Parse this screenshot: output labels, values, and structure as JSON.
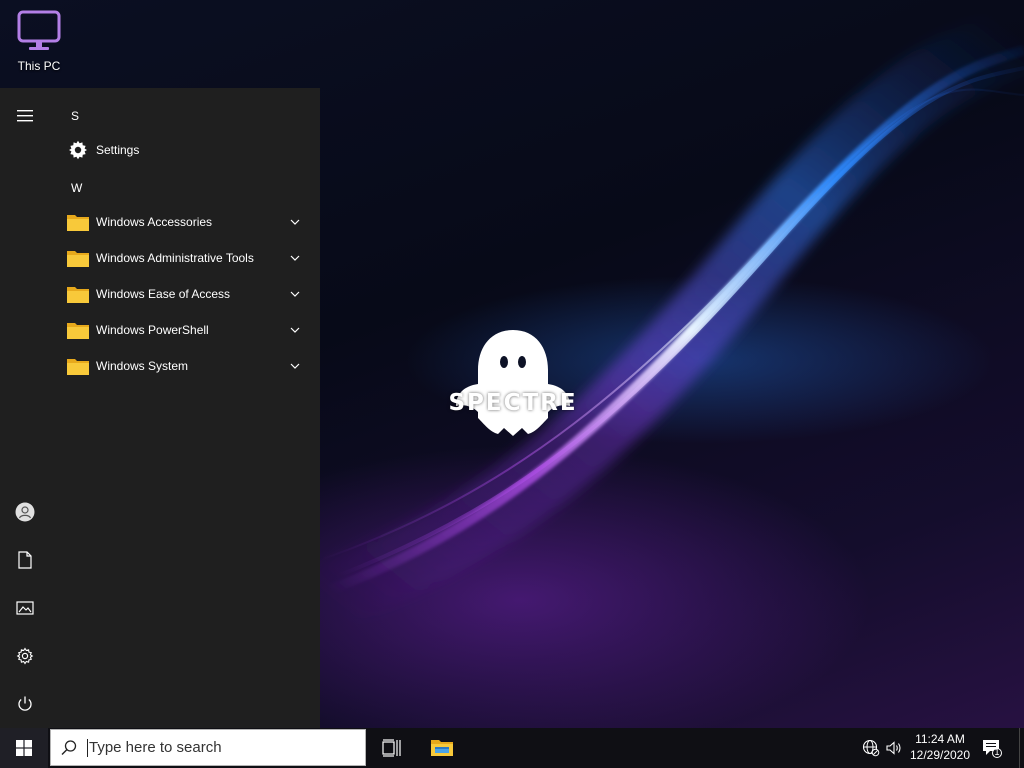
{
  "desktop": {
    "icons": [
      {
        "label": "This PC"
      }
    ],
    "wallpaper_logo_text": "SPECTRE"
  },
  "start_menu": {
    "groups": [
      {
        "letter": "S",
        "items": [
          {
            "label": "Settings",
            "icon": "gear-icon",
            "expandable": false
          }
        ]
      },
      {
        "letter": "W",
        "items": [
          {
            "label": "Windows Accessories",
            "icon": "folder-icon",
            "expandable": true
          },
          {
            "label": "Windows Administrative Tools",
            "icon": "folder-icon",
            "expandable": true
          },
          {
            "label": "Windows Ease of Access",
            "icon": "folder-icon",
            "expandable": true
          },
          {
            "label": "Windows PowerShell",
            "icon": "folder-icon",
            "expandable": true
          },
          {
            "label": "Windows System",
            "icon": "folder-icon",
            "expandable": true
          }
        ]
      }
    ],
    "rail": [
      "hamburger-menu-icon",
      "user-account-icon",
      "documents-icon",
      "pictures-icon",
      "settings-icon",
      "power-icon"
    ]
  },
  "taskbar": {
    "search_placeholder": "Type here to search",
    "pinned": [
      "task-view-icon",
      "file-explorer-icon"
    ],
    "tray": {
      "time": "11:24 AM",
      "date": "12/29/2020",
      "notification_count": "1"
    }
  },
  "colors": {
    "start_menu_bg": "#1f1f1f",
    "taskbar_bg": "#0f0f14",
    "folder_yellow": "#f8c93a",
    "this_pc_accent": "#b37fe6"
  }
}
